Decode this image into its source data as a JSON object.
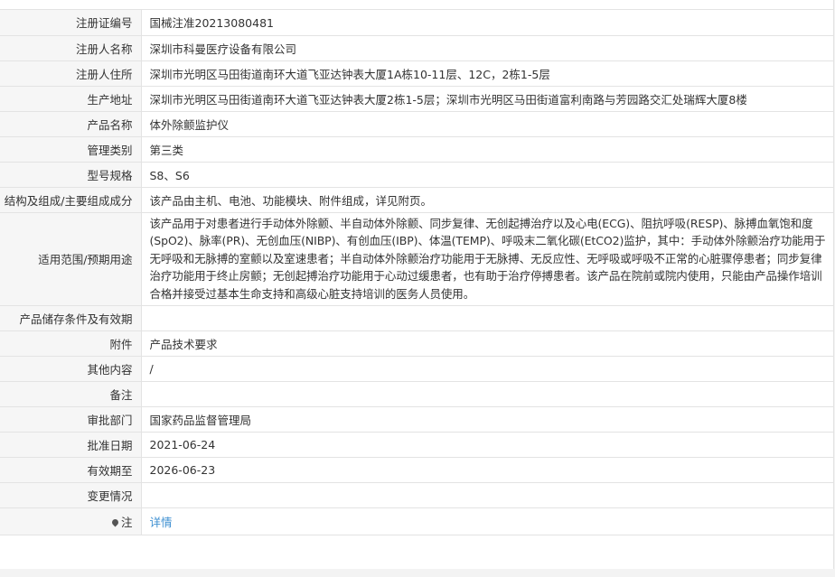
{
  "rows": [
    {
      "label": "注册证编号",
      "value": "国械注准20213080481"
    },
    {
      "label": "注册人名称",
      "value": "深圳市科曼医疗设备有限公司"
    },
    {
      "label": "注册人住所",
      "value": "深圳市光明区马田街道南环大道飞亚达钟表大厦1A栋10-11层、12C，2栋1-5层"
    },
    {
      "label": "生产地址",
      "value": "深圳市光明区马田街道南环大道飞亚达钟表大厦2栋1-5层；深圳市光明区马田街道富利南路与芳园路交汇处瑞辉大厦8楼"
    },
    {
      "label": "产品名称",
      "value": "体外除颤监护仪"
    },
    {
      "label": "管理类别",
      "value": "第三类"
    },
    {
      "label": "型号规格",
      "value": "S8、S6"
    },
    {
      "label": "结构及组成/主要组成成分",
      "value": "该产品由主机、电池、功能模块、附件组成，详见附页。"
    },
    {
      "label": "适用范围/预期用途",
      "value": "该产品用于对患者进行手动体外除颤、半自动体外除颤、同步复律、无创起搏治疗以及心电(ECG)、阻抗呼吸(RESP)、脉搏血氧饱和度(SpO2)、脉率(PR)、无创血压(NIBP)、有创血压(IBP)、体温(TEMP)、呼吸末二氧化碳(EtCO2)监护，其中：手动体外除颤治疗功能用于无呼吸和无脉搏的室颤以及室速患者；半自动体外除颤治疗功能用于无脉搏、无反应性、无呼吸或呼吸不正常的心脏骤停患者；同步复律治疗功能用于终止房颤；无创起搏治疗功能用于心动过缓患者，也有助于治疗停搏患者。该产品在院前或院内使用，只能由产品操作培训合格并接受过基本生命支持和高级心脏支持培训的医务人员使用。"
    },
    {
      "label": "产品储存条件及有效期",
      "value": ""
    },
    {
      "label": "附件",
      "value": "产品技术要求"
    },
    {
      "label": "其他内容",
      "value": "/"
    },
    {
      "label": "备注",
      "value": ""
    },
    {
      "label": "审批部门",
      "value": "国家药品监督管理局"
    },
    {
      "label": "批准日期",
      "value": "2021-06-24"
    },
    {
      "label": "有效期至",
      "value": "2026-06-23"
    },
    {
      "label": "变更情况",
      "value": ""
    },
    {
      "label": "注",
      "value": "详情",
      "icon": "pin-icon"
    }
  ]
}
